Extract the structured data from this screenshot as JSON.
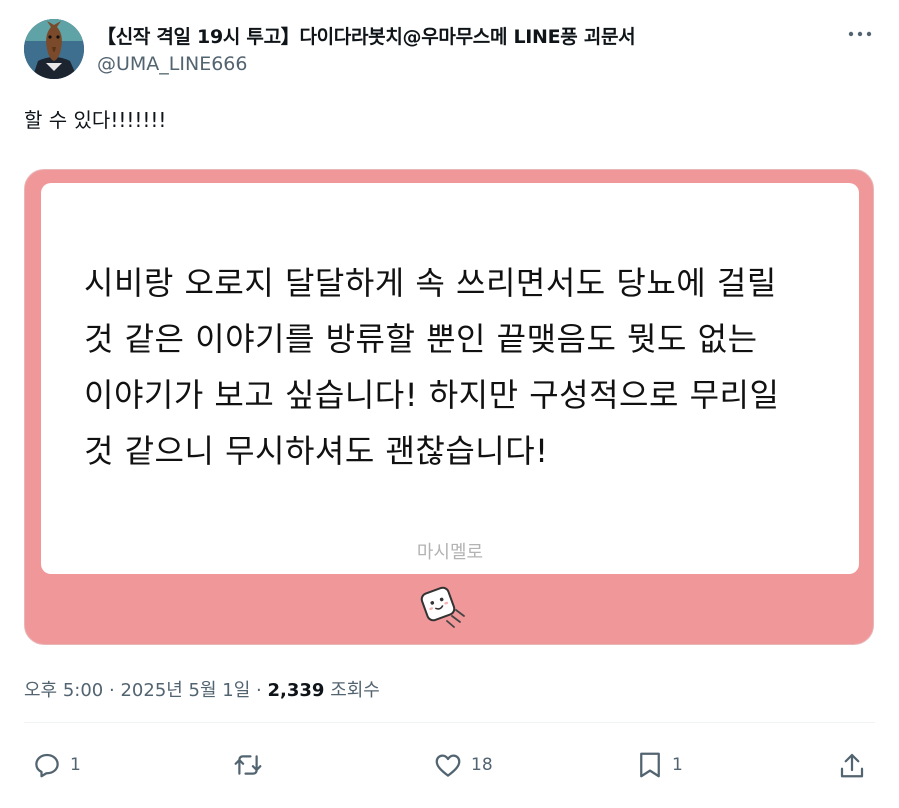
{
  "author": {
    "display_name": "【신작 격일 19시 투고】다이다라봇치@우마무스메 LINE풍 괴문서",
    "handle": "@UMA_LINE666",
    "avatar_icon": "horse-avatar-icon"
  },
  "tweet": {
    "text": "할 수 있다!!!!!!!"
  },
  "card": {
    "text": "시비랑 오로지 달달하게 속 쓰리면서도 당뇨에 걸릴\n것 같은 이야기를 방류할 뿐인 끝맺음도 뭣도 없는\n이야기가 보고 싶습니다! 하지만 구성적으로 무리일\n것 같으니 무시하셔도 괜찮습니다!",
    "brand": "마시멜로",
    "logo_icon": "marshmallow-logo-icon",
    "background_color": "#f0979a"
  },
  "meta": {
    "time": "오후 5:00",
    "separator": "·",
    "date": "2025년 5월 1일",
    "views_count": "2,339",
    "views_label": "조회수"
  },
  "actions": {
    "reply_count": "1",
    "retweet_count": "",
    "like_count": "18",
    "bookmark_count": "1"
  }
}
